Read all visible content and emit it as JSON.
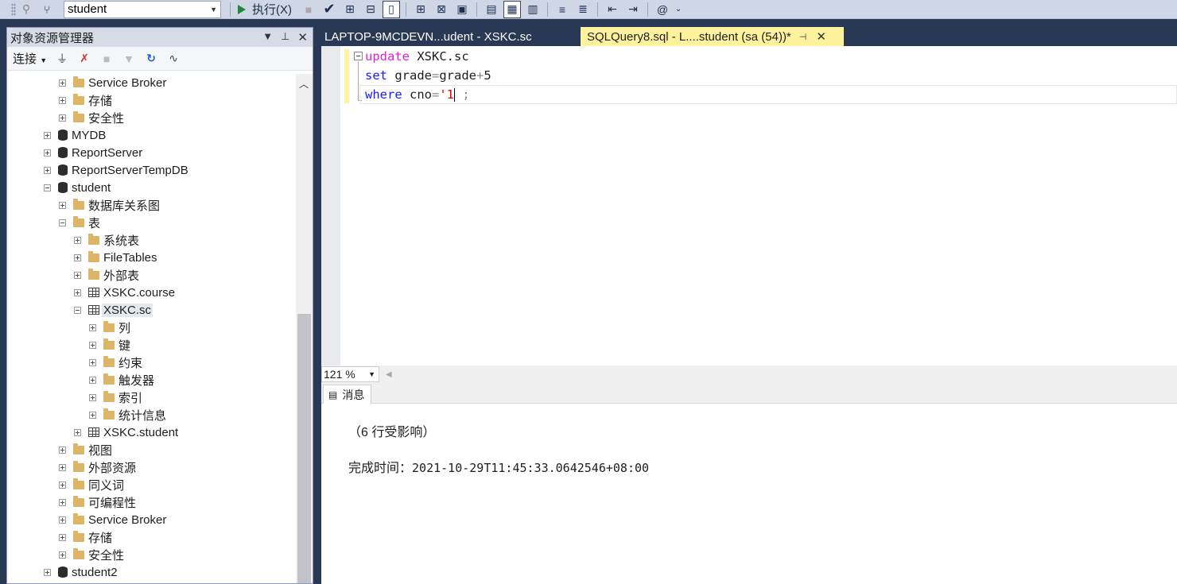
{
  "toolbar": {
    "database": "student",
    "execute_label": "执行(X)"
  },
  "explorer": {
    "title": "对象资源管理器",
    "connect_label": "连接",
    "tree": [
      {
        "label": "Service Broker",
        "toggle": "plus",
        "icon": "folder-icon",
        "depth": 2
      },
      {
        "label": "存储",
        "toggle": "plus",
        "icon": "folder-icon",
        "depth": 2
      },
      {
        "label": "安全性",
        "toggle": "plus",
        "icon": "folder-icon",
        "depth": 2
      },
      {
        "label": "MYDB",
        "toggle": "plus",
        "icon": "database-icon",
        "depth": 1
      },
      {
        "label": "ReportServer",
        "toggle": "plus",
        "icon": "database-icon",
        "depth": 1
      },
      {
        "label": "ReportServerTempDB",
        "toggle": "plus",
        "icon": "database-icon",
        "depth": 1
      },
      {
        "label": "student",
        "toggle": "minus",
        "icon": "database-icon",
        "depth": 1
      },
      {
        "label": "数据库关系图",
        "toggle": "plus",
        "icon": "folder-icon",
        "depth": 2
      },
      {
        "label": "表",
        "toggle": "minus",
        "icon": "folder-icon",
        "depth": 2
      },
      {
        "label": "系统表",
        "toggle": "plus",
        "icon": "folder-icon",
        "depth": 3
      },
      {
        "label": "FileTables",
        "toggle": "plus",
        "icon": "folder-icon",
        "depth": 3
      },
      {
        "label": "外部表",
        "toggle": "plus",
        "icon": "folder-icon",
        "depth": 3
      },
      {
        "label": "XSKC.course",
        "toggle": "plus",
        "icon": "table-icon",
        "depth": 3
      },
      {
        "label": "XSKC.sc",
        "toggle": "minus",
        "icon": "table-icon",
        "depth": 3,
        "selected": true
      },
      {
        "label": "列",
        "toggle": "plus",
        "icon": "folder-icon",
        "depth": 4
      },
      {
        "label": "键",
        "toggle": "plus",
        "icon": "folder-icon",
        "depth": 4
      },
      {
        "label": "约束",
        "toggle": "plus",
        "icon": "folder-icon",
        "depth": 4
      },
      {
        "label": "触发器",
        "toggle": "plus",
        "icon": "folder-icon",
        "depth": 4
      },
      {
        "label": "索引",
        "toggle": "plus",
        "icon": "folder-icon",
        "depth": 4
      },
      {
        "label": "统计信息",
        "toggle": "plus",
        "icon": "folder-icon",
        "depth": 4
      },
      {
        "label": "XSKC.student",
        "toggle": "plus",
        "icon": "table-icon",
        "depth": 3
      },
      {
        "label": "视图",
        "toggle": "plus",
        "icon": "folder-icon",
        "depth": 2
      },
      {
        "label": "外部资源",
        "toggle": "plus",
        "icon": "folder-icon",
        "depth": 2
      },
      {
        "label": "同义词",
        "toggle": "plus",
        "icon": "folder-icon",
        "depth": 2
      },
      {
        "label": "可编程性",
        "toggle": "plus",
        "icon": "folder-icon",
        "depth": 2
      },
      {
        "label": "Service Broker",
        "toggle": "plus",
        "icon": "folder-icon",
        "depth": 2
      },
      {
        "label": "存储",
        "toggle": "plus",
        "icon": "folder-icon",
        "depth": 2
      },
      {
        "label": "安全性",
        "toggle": "plus",
        "icon": "folder-icon",
        "depth": 2
      },
      {
        "label": "student2",
        "toggle": "plus",
        "icon": "database-icon",
        "depth": 1
      }
    ]
  },
  "tabs": {
    "inactive": "LAPTOP-9MCDEVN...udent - XSKC.sc",
    "active": "SQLQuery8.sql - L....student (sa (54))*"
  },
  "editor": {
    "line1_kw": "update",
    "line1_rest": " XSKC.sc",
    "line2_kw": "set",
    "line2_rest": " grade",
    "line2_op1": "=",
    "line2_mid": "grade",
    "line2_op2": "+",
    "line2_end": "5",
    "line3_kw": "where",
    "line3_rest": " cno",
    "line3_op": "=",
    "line3_str": "'1",
    "line3_end": " ;"
  },
  "zoom": "121 %",
  "results": {
    "tab_label": "消息",
    "line1": "（6 行受影响）",
    "line2_label": "完成时间：",
    "line2_value": "2021-10-29T11:45:33.0642546+08:00"
  }
}
